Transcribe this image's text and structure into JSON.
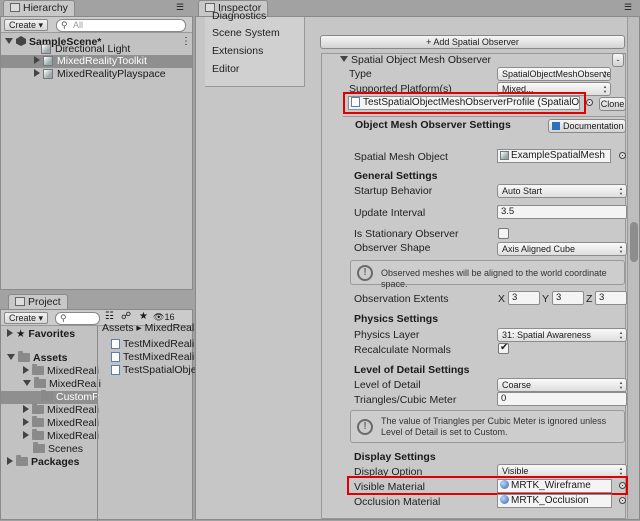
{
  "hierarchy": {
    "tab_label": "Hierarchy",
    "create_label": "Create",
    "search_placeholder": "All",
    "scene_name": "SampleScene*",
    "items": [
      "Directional Light",
      "MixedRealityToolkit",
      "MixedRealityPlayspace"
    ]
  },
  "project": {
    "tab_label": "Project",
    "create_label": "Create",
    "badge": "16",
    "favorites": "Favorites",
    "assets": "Assets",
    "folders": [
      "MixedReali",
      "MixedReali",
      "CustomP",
      "MixedReali",
      "MixedReali",
      "MixedReali",
      "Scenes"
    ],
    "packages": "Packages",
    "breadcrumb": [
      "Assets",
      "MixedReali"
    ],
    "files": [
      "TestMixedReali",
      "TestMixedReali",
      "TestSpatialObje"
    ]
  },
  "inspector": {
    "tab_label": "Inspector",
    "side_menu": [
      "Diagnostics",
      "Scene System",
      "Extensions",
      "Editor"
    ],
    "add_observer_label": "+ Add Spatial Observer",
    "observer_title": "Spatial Object Mesh Observer",
    "remove_label": "-",
    "type_label": "Type",
    "type_value": "SpatialObjectMeshObserver",
    "platform_label": "Supported Platform(s)",
    "platform_value": "Mixed...",
    "profile_value": "TestSpatialObjectMeshObserverProfile (SpatialO",
    "clone_label": "Clone",
    "settings_title": "Object Mesh Observer Settings",
    "documentation_label": "Documentation",
    "spatial_mesh_label": "Spatial Mesh Object",
    "spatial_mesh_value": "ExampleSpatialMesh",
    "general_header": "General Settings",
    "startup_label": "Startup Behavior",
    "startup_value": "Auto Start",
    "update_label": "Update Interval",
    "update_value": "3.5",
    "stationary_label": "Is Stationary Observer",
    "shape_label": "Observer Shape",
    "shape_value": "Axis Aligned Cube",
    "shape_info": "Observed meshes will be aligned to the world coordinate space.",
    "extents_label": "Observation Extents",
    "extents": {
      "x_label": "X",
      "x": "3",
      "y_label": "Y",
      "y": "3",
      "z_label": "Z",
      "z": "3"
    },
    "physics_header": "Physics Settings",
    "physics_layer_label": "Physics Layer",
    "physics_layer_value": "31: Spatial Awareness",
    "recalc_label": "Recalculate Normals",
    "lod_header": "Level of Detail Settings",
    "lod_label": "Level of Detail",
    "lod_value": "Coarse",
    "tri_label": "Triangles/Cubic Meter",
    "tri_value": "0",
    "lod_info": "The value of Triangles per Cubic Meter is ignored unless Level of Detail is set to Custom.",
    "display_header": "Display Settings",
    "display_option_label": "Display Option",
    "display_option_value": "Visible",
    "visible_material_label": "Visible Material",
    "visible_material_value": "MRTK_Wireframe",
    "occlusion_label": "Occlusion Material",
    "occlusion_value": "MRTK_Occlusion"
  },
  "colors": {
    "highlight_red": "#e00000",
    "selection": "#8f8f8f"
  }
}
